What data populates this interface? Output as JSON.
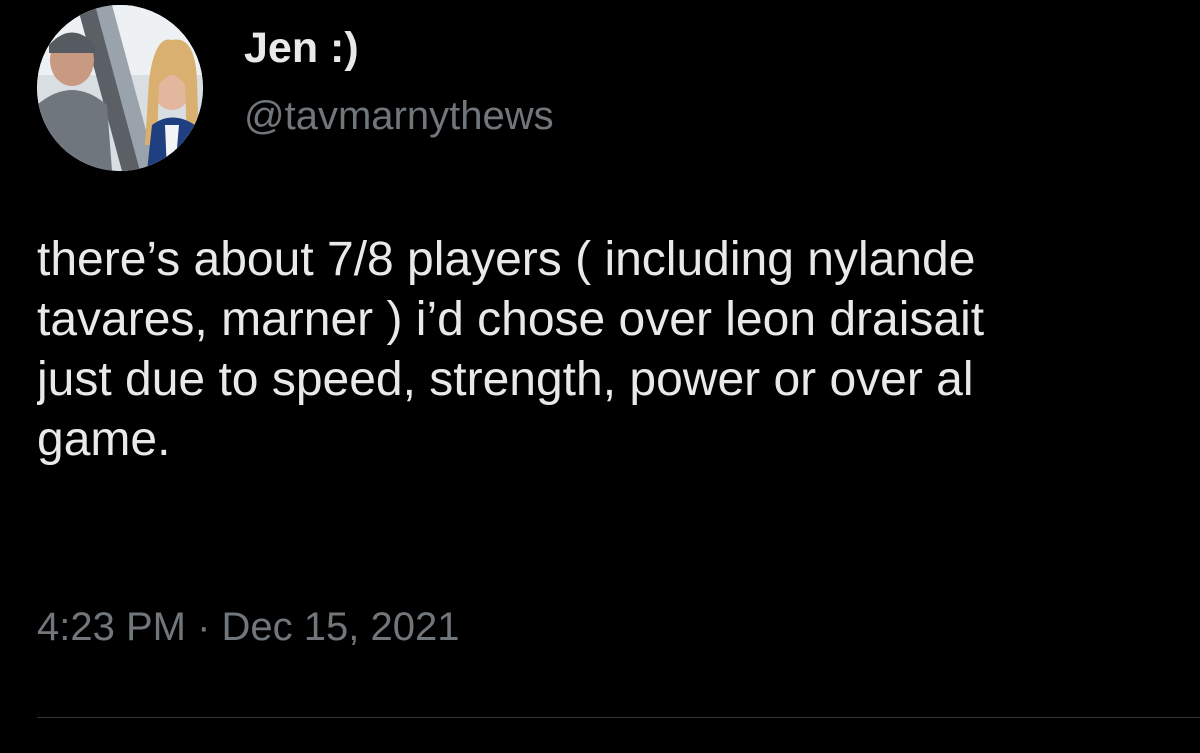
{
  "tweet": {
    "author": {
      "display_name": "Jen :)",
      "handle": "@tavmarnythews",
      "avatar_icon": "avatar-photo"
    },
    "text_lines": [
      "there’s about 7/8 players ( including nylande",
      "tavares, marner ) i’d chose over leon draisait",
      "just due to speed, strength, power or over al",
      "game."
    ],
    "time": "4:23 PM",
    "separator": "·",
    "date": "Dec 15, 2021"
  },
  "colors": {
    "background": "#000000",
    "primary_text": "#e7e9ea",
    "secondary_text": "#71767b",
    "divider": "#2f3336"
  }
}
